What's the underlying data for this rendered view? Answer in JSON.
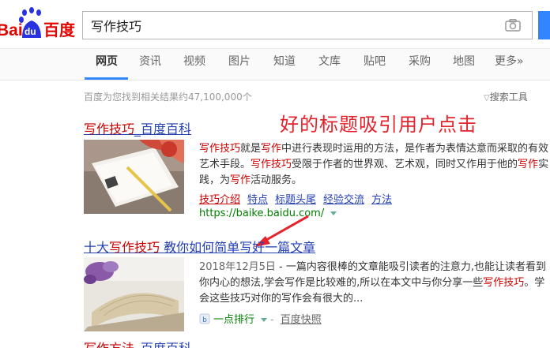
{
  "logo": {
    "text_bai": "Bai",
    "text_du": "du",
    "text_cn": "百度"
  },
  "search": {
    "query": "写作技巧"
  },
  "tabs": [
    {
      "label": "网页",
      "active": true
    },
    {
      "label": "资讯"
    },
    {
      "label": "视频"
    },
    {
      "label": "图片"
    },
    {
      "label": "知道"
    },
    {
      "label": "文库"
    },
    {
      "label": "贴吧"
    },
    {
      "label": "采购"
    },
    {
      "label": "地图"
    },
    {
      "label": "更多»"
    }
  ],
  "stats": {
    "text": "百度为您找到相关结果约47,100,000个",
    "tools": "搜索工具"
  },
  "annotation": "好的标题吸引用户点击",
  "results": [
    {
      "title_hl": "写作技巧",
      "title_rest": "_百度百科",
      "abstract": [
        {
          "t": "写作技巧",
          "h": true
        },
        {
          "t": "就是",
          "h": false
        },
        {
          "t": "写作",
          "h": true
        },
        {
          "t": "中进行表现时运用的方法，是作者为表情达意而采取的有效艺术手段。",
          "h": false
        },
        {
          "t": "写作技巧",
          "h": true
        },
        {
          "t": "受限于作者的世界观、艺术观，同时又作用于他的",
          "h": false
        },
        {
          "t": "写作",
          "h": true
        },
        {
          "t": "实践，为",
          "h": false
        },
        {
          "t": "写作",
          "h": true
        },
        {
          "t": "活动服务。",
          "h": false
        }
      ],
      "sublinks": [
        "技巧介绍",
        "特点",
        "标题头尾",
        "经验交流",
        "方法"
      ],
      "url": "https://baike.baidu.com/"
    },
    {
      "title_pre": "十大",
      "title_hl": "写作技巧",
      "title_rest": " 教你如何简单写好一篇文章",
      "date": "2018年12月5日",
      "abstract_a": " - 一篇内容很棒的文章能吸引读者的注意力,也能让读者看到你内心的想法,学会写作是比较难的,所以在本文中与你分享一些",
      "abstract_hl": "写作技巧",
      "abstract_b": "。学会这些技巧对你的写作会有很大的...",
      "source": "一点排行",
      "snapshot": "百度快照"
    },
    {
      "title_hl": "写作方法",
      "title_rest": "_百度百科"
    }
  ],
  "colors": {
    "brand_red": "#e10602",
    "brand_blue": "#2932e1",
    "link": "#2440b3",
    "highlight": "#c00",
    "green": "#008000",
    "annotation": "#e4232c"
  }
}
